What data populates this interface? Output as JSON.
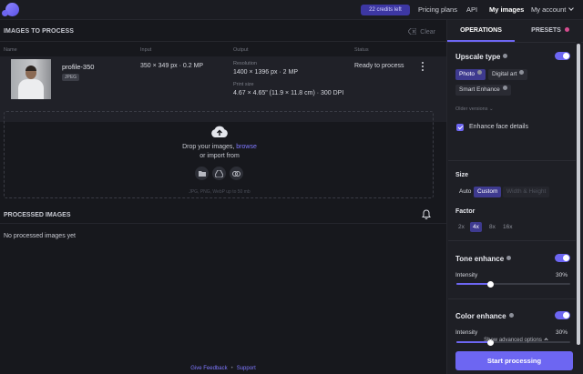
{
  "header": {
    "credits": "22 credits left",
    "nav": [
      "Pricing plans",
      "API",
      "My images",
      "My account"
    ],
    "active_nav": "My images"
  },
  "images": {
    "title": "IMAGES TO PROCESS",
    "clear_label": "Clear",
    "columns": [
      "Name",
      "Input",
      "Output",
      "Status"
    ],
    "rows": [
      {
        "name": "profile-350",
        "format": "JPEG",
        "input": "350 × 349 px · 0.2 MP",
        "resolution_label": "Resolution",
        "resolution": "1400 × 1396 px · 2 MP",
        "print_label": "Print size",
        "print_size": "4.67 × 4.65\" (11.9 × 11.8 cm) · 300 DPI",
        "status": "Ready to process"
      }
    ]
  },
  "dropzone": {
    "text": "Drop your images,",
    "link": "browse",
    "import_text": "or import from",
    "sources": [
      "folder-icon",
      "google-drive-icon",
      "link-icon"
    ],
    "formats": "JPG, PNG, WebP up to 50 mb"
  },
  "processed": {
    "title": "PROCESSED IMAGES",
    "empty": "No processed images yet"
  },
  "footer": {
    "feedback": "Give Feedback",
    "support": "Support"
  },
  "sidebar": {
    "tabs": [
      "OPERATIONS",
      "PRESETS"
    ],
    "active_tab": "OPERATIONS",
    "upscale": {
      "title": "Upscale type",
      "enabled": true,
      "types": [
        "Photo",
        "Digital art",
        "Smart Enhance"
      ],
      "selected": "Photo",
      "older_versions": "Older versions",
      "face_details_label": "Enhance face details",
      "face_details_checked": true
    },
    "size": {
      "label": "Size",
      "options": [
        "Auto",
        "Custom",
        "Width & Height"
      ],
      "selected": "Custom"
    },
    "factor": {
      "label": "Factor",
      "options": [
        "2x",
        "4x",
        "8x",
        "16x"
      ],
      "selected": "4x"
    },
    "tone": {
      "title": "Tone enhance",
      "enabled": true,
      "intensity_label": "Intensity",
      "intensity": "30%",
      "intensity_fraction": 0.3
    },
    "color": {
      "title": "Color enhance",
      "enabled": true,
      "intensity_label": "Intensity",
      "intensity": "30%",
      "intensity_fraction": 0.3
    },
    "advanced_label": "Show advanced options",
    "start_label": "Start processing"
  },
  "colors": {
    "accent": "#6d66f2",
    "background": "#17181d",
    "panel": "#1e1f25"
  }
}
